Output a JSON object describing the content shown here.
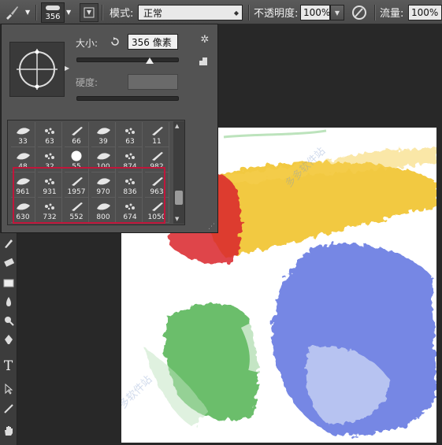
{
  "options_bar": {
    "brush_size": "356",
    "mode_label": "模式:",
    "mode_value": "正常",
    "opacity_label": "不透明度:",
    "opacity_value": "100%",
    "flow_label": "流量:",
    "flow_value": "100%"
  },
  "brush_panel": {
    "size_label": "大小:",
    "size_value": "356 像素",
    "size_level": 0.72,
    "hardness_label": "硬度:",
    "hardness_value": "",
    "brush_sizes": [
      [
        "33",
        "63",
        "66",
        "39",
        "63",
        "11"
      ],
      [
        "48",
        "32",
        "55",
        "100",
        "874",
        "982"
      ],
      [
        "961",
        "931",
        "1957",
        "970",
        "836",
        "963"
      ],
      [
        "630",
        "732",
        "552",
        "800",
        "674",
        "1050"
      ]
    ]
  },
  "tools": [
    "spot-healing-icon",
    "eraser-icon",
    "gradient-icon",
    "blur-icon",
    "dodge-icon",
    "pen-icon",
    "type-icon",
    "path-select-icon",
    "line-icon",
    "hand-icon"
  ],
  "watermark": "多多软件站",
  "colors": {
    "highlight": "#c0163b",
    "red": "#d9262b",
    "yellow": "#f0c020",
    "green": "#3aa83a",
    "blue": "#3a55d8"
  }
}
